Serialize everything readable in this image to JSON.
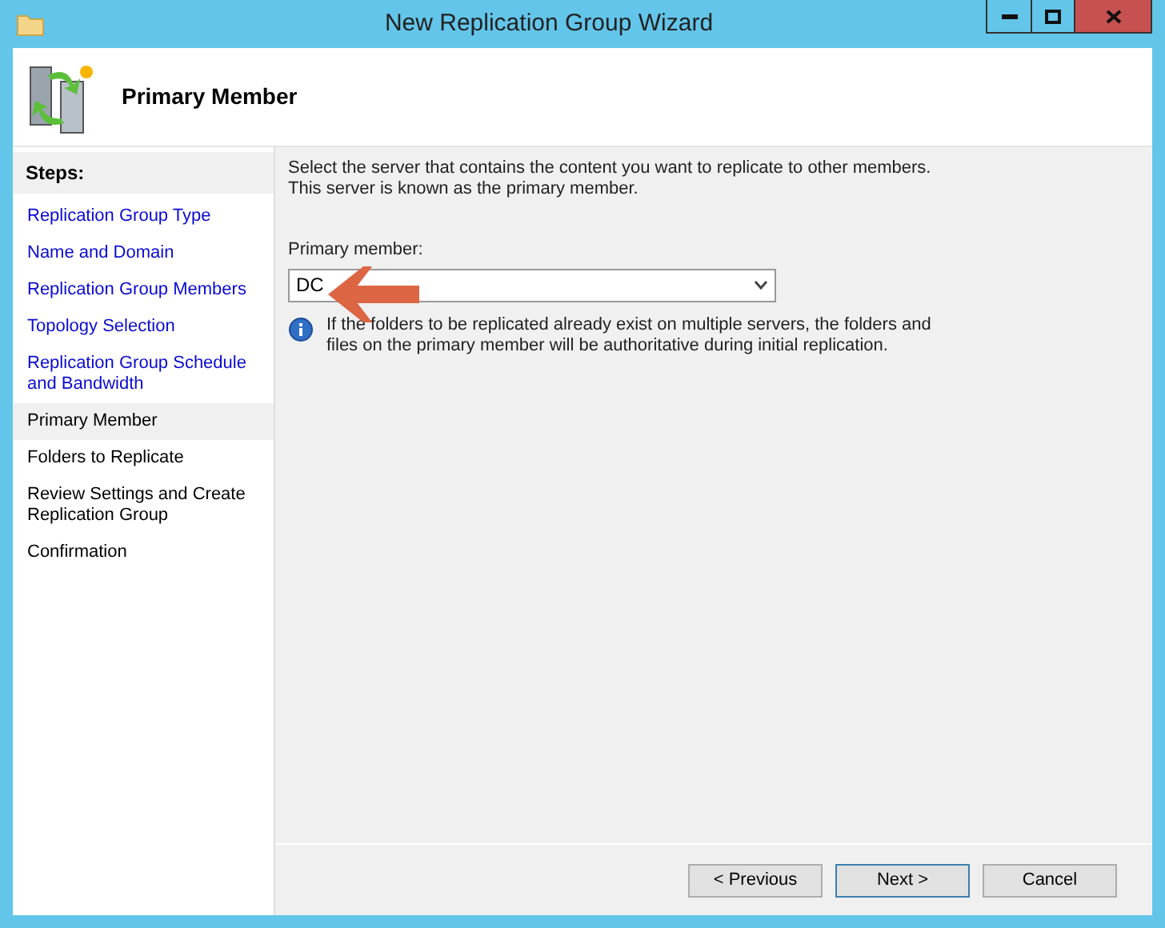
{
  "window": {
    "title": "New Replication Group Wizard"
  },
  "header": {
    "title": "Primary Member"
  },
  "steps": {
    "heading": "Steps:",
    "items": [
      {
        "label": "Replication Group Type",
        "visited": true,
        "selected": false
      },
      {
        "label": "Name and Domain",
        "visited": true,
        "selected": false
      },
      {
        "label": "Replication Group Members",
        "visited": true,
        "selected": false
      },
      {
        "label": "Topology Selection",
        "visited": true,
        "selected": false
      },
      {
        "label": "Replication Group Schedule and Bandwidth",
        "visited": true,
        "selected": false
      },
      {
        "label": "Primary Member",
        "visited": false,
        "selected": true
      },
      {
        "label": "Folders to Replicate",
        "visited": false,
        "selected": false
      },
      {
        "label": "Review Settings and Create Replication Group",
        "visited": false,
        "selected": false
      },
      {
        "label": "Confirmation",
        "visited": false,
        "selected": false
      }
    ]
  },
  "content": {
    "intro": "Select the server that contains the content you want to replicate to other members. This server is known as the primary member.",
    "field_label": "Primary member:",
    "field_value": "DC",
    "info": "If the folders to be replicated already exist on multiple servers, the folders and files on the primary member will be authoritative during initial replication."
  },
  "buttons": [
    {
      "label": "< Previous",
      "selected": false
    },
    {
      "label": "Next >",
      "selected": true
    },
    {
      "label": "Cancel",
      "selected": false
    }
  ]
}
